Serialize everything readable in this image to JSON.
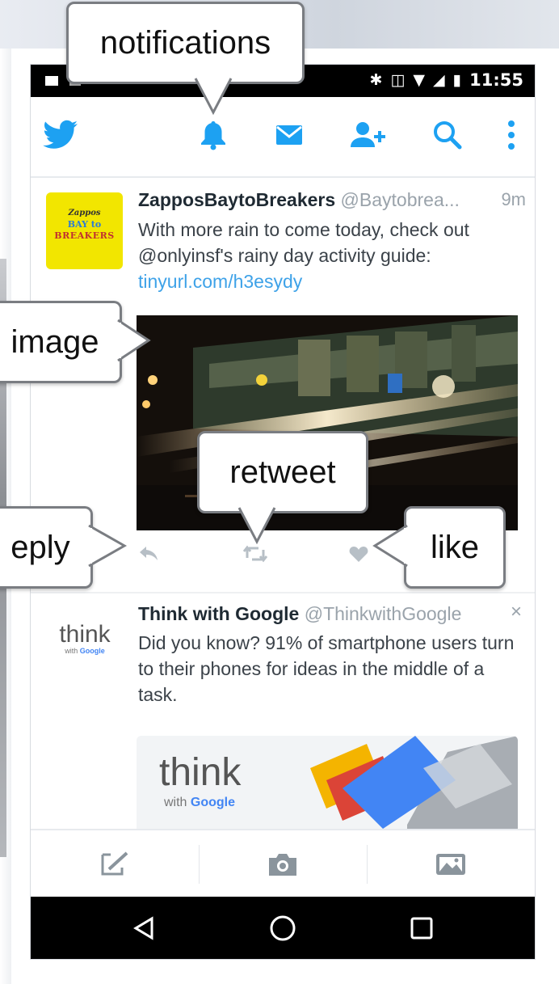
{
  "statusbar": {
    "time": "11:55"
  },
  "toolbar": {
    "icons": [
      "twitter-bird-icon",
      "bell-icon",
      "envelope-icon",
      "add-user-icon",
      "search-icon",
      "overflow-menu-icon"
    ],
    "accent_color": "#1da1f2"
  },
  "tweets": [
    {
      "avatar_lines": [
        "Zappos",
        "BAY to",
        "BREAKERS"
      ],
      "name": "ZapposBaytoBreakers",
      "handle": "@Baytobrea...",
      "time": "9m",
      "text": "With more rain to come today, check out @onlyinsf's rainy day activity guide: ",
      "link": "tinyurl.com/h3esydy"
    },
    {
      "avatar_word": "think",
      "avatar_sub": "with",
      "avatar_brand": "Google",
      "name": "Think with Google",
      "handle": "@ThinkwithGoogle",
      "dismiss": "×",
      "text": "Did you know? 91% of smartphone users turn to their phones for ideas in the middle of a task.",
      "card_word": "think",
      "card_sub": "with",
      "card_brand": "Google"
    }
  ],
  "tweet_actions": [
    "reply-icon",
    "retweet-icon",
    "like-icon"
  ],
  "bottom_tabs": [
    "compose-tweet-icon",
    "camera-icon",
    "gallery-icon"
  ],
  "navbar": [
    "back-icon",
    "home-icon",
    "recents-icon"
  ],
  "callouts": {
    "notifications": "notifications",
    "image": "image",
    "retweet": "retweet",
    "reply": "eply",
    "like": "like"
  }
}
